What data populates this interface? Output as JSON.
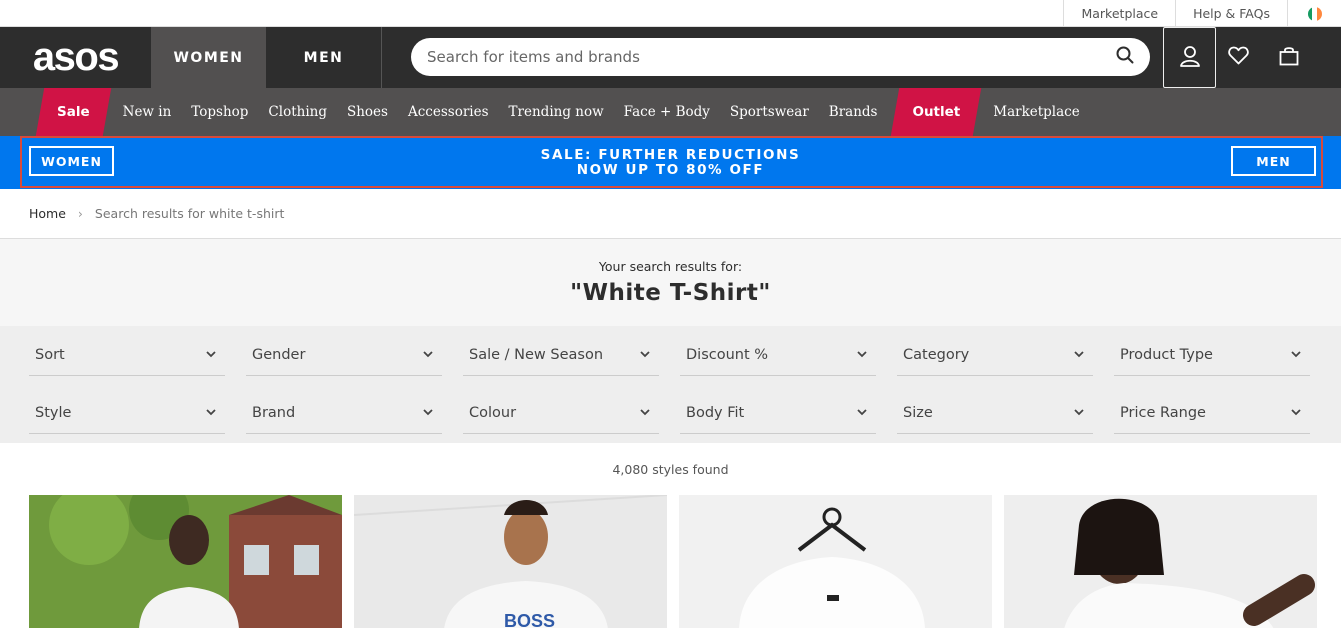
{
  "util_bar": {
    "marketplace": "Marketplace",
    "help": "Help & FAQs"
  },
  "header": {
    "logo": "asos",
    "tabs": [
      "WOMEN",
      "MEN"
    ],
    "search_placeholder": "Search for items and brands"
  },
  "category_nav": {
    "items": [
      "Sale",
      "New in",
      "Topshop",
      "Clothing",
      "Shoes",
      "Accessories",
      "Trending now",
      "Face + Body",
      "Sportswear",
      "Brands",
      "Outlet",
      "Marketplace"
    ]
  },
  "promo": {
    "women_button": "WOMEN",
    "men_button": "MEN",
    "line1": "SALE: FURTHER REDUCTIONS",
    "line2": "NOW UP TO 80% OFF"
  },
  "breadcrumb": {
    "home": "Home",
    "separator": "›",
    "current": "Search results for white t-shirt"
  },
  "search": {
    "subtitle": "Your search results for:",
    "term": "\"White T-Shirt\""
  },
  "filters": {
    "row1": [
      "Sort",
      "Gender",
      "Sale / New Season",
      "Discount %",
      "Category",
      "Product Type"
    ],
    "row2": [
      "Style",
      "Brand",
      "Colour",
      "Body Fit",
      "Size",
      "Price Range"
    ]
  },
  "results": {
    "count_text": "4,080 styles found"
  },
  "colors": {
    "header_bg": "#2d2d2d",
    "nav_bg": "#525050",
    "sale_red": "#d01345",
    "promo_blue": "#0077ee",
    "highlight_outline": "#d84a3a"
  }
}
